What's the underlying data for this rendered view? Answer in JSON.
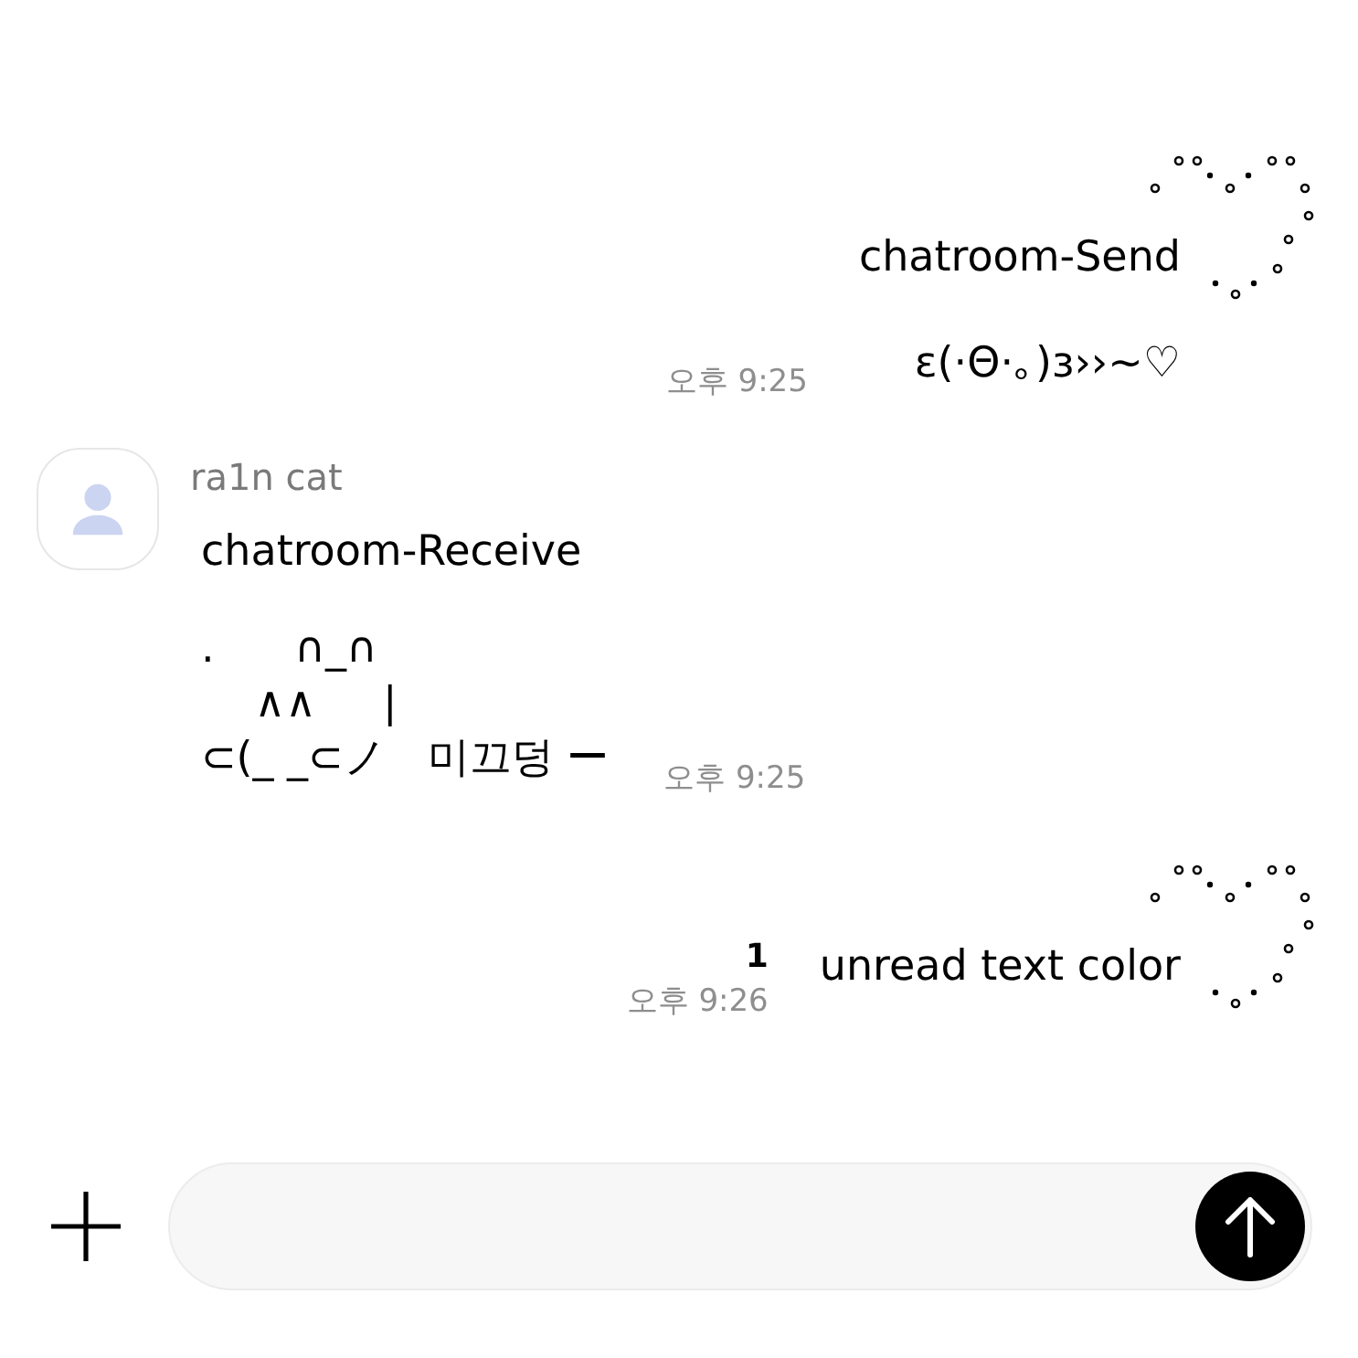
{
  "messages": [
    {
      "kind": "sent",
      "paragraphs": [
        "chatroom-Send",
        "ɛ(·Θ·｡)ɜ››~♡"
      ],
      "time": "오후 9:25"
    },
    {
      "kind": "received",
      "sender": "ra1n cat",
      "paragraphs": [
        "chatroom-Receive",
        ".      ∩_∩\n    ∧∧     |\n⊂(_ _⊂ノ   미끄덩 ー"
      ],
      "time": "오후 9:25"
    },
    {
      "kind": "sent",
      "paragraphs": [
        "unread text color"
      ],
      "unread_count": "1",
      "time": "오후 9:26"
    }
  ]
}
